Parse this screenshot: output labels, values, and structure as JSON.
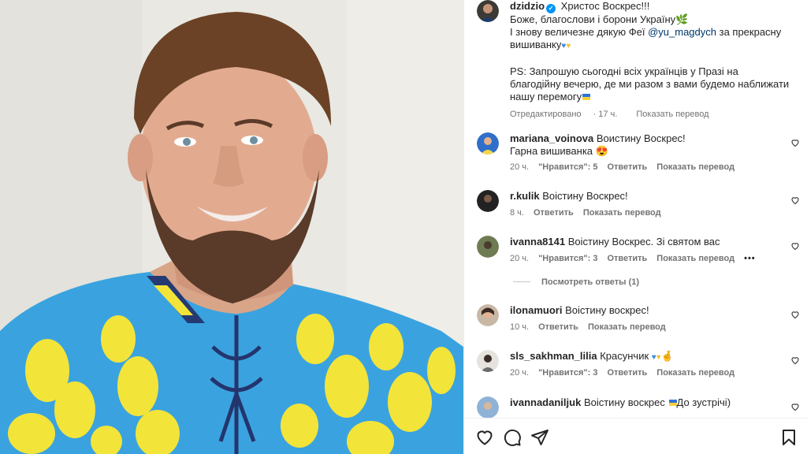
{
  "post": {
    "author": "dzidzio",
    "caption": {
      "line1": "Христос Воскрес!!!",
      "line2": "Боже, благослови і борони Україну",
      "line3_pre": "І знову величезне дякую Феї ",
      "mention": "@yu_magdych",
      "line3_post": " за прекрасну",
      "line4": "вишиванку",
      "line5": "PS: Запрошую сьогодні всіх українців у Празі на",
      "line6": "благодійну вечерю, де ми разом з вами будемо наближати",
      "line7": "нашу перемогу"
    },
    "edited": "Отредактировано",
    "time": "17 ч.",
    "translate": "Показать перевод"
  },
  "comments": [
    {
      "username": "mariana_voinova",
      "text": "Воистину Воскрес!",
      "text2": "Гарна вишиванка",
      "time": "20 ч.",
      "likes": "\"Нравится\": 5",
      "reply": "Ответить",
      "translate": "Показать перевод"
    },
    {
      "username": "r.kulik",
      "text": "Воістину Воскрес!",
      "time": "8 ч.",
      "reply": "Ответить",
      "translate": "Показать перевод"
    },
    {
      "username": "ivanna8141",
      "text": "Воістину Воскрес. Зі святом вас",
      "time": "20 ч.",
      "likes": "\"Нравится\": 3",
      "reply": "Ответить",
      "translate": "Показать перевод",
      "more": "•••"
    },
    {
      "username": "ilonamuori",
      "text": "Воістину воскрес!",
      "time": "10 ч.",
      "reply": "Ответить",
      "translate": "Показать перевод"
    },
    {
      "username": "sls_sakhman_lilia",
      "text": "Красунчик",
      "time": "20 ч.",
      "likes": "\"Нравится\": 3",
      "reply": "Ответить",
      "translate": "Показать перевод"
    },
    {
      "username": "ivannadaniljuk",
      "text": "Воістину воскрес",
      "text_after": "До зустрічі)"
    }
  ],
  "view_replies": "Посмотреть ответы (1)",
  "icons": {
    "like": "heart-icon",
    "comment": "comment-icon",
    "share": "share-icon",
    "save": "bookmark-icon",
    "comment_like": "small-heart-icon",
    "verified": "verified-badge-icon"
  },
  "colors": {
    "link": "#00376b",
    "meta": "#737373",
    "verified": "#0095f6",
    "shirt": "#3aa3df",
    "embroidery": "#f3e43a"
  }
}
